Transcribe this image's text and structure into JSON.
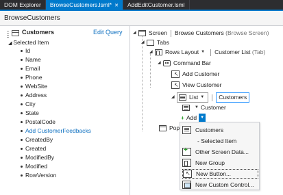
{
  "tabs": [
    {
      "label": "DOM Explorer"
    },
    {
      "label": "BrowseCustomers.lsml*"
    },
    {
      "label": "AddEditCustomer.lsml"
    }
  ],
  "header": {
    "title": "BrowseCustomers"
  },
  "left": {
    "title": "Customers",
    "edit_query": "Edit Query",
    "selected_item": "Selected Item",
    "fields": [
      "Id",
      "Name",
      "Email",
      "Phone",
      "WebSite",
      "Address",
      "City",
      "State",
      "PostalCode"
    ],
    "add_link": "Add CustomerFeedbacks",
    "fields2": [
      "CreatedBy",
      "Created",
      "ModifiedBy",
      "Modified",
      "RowVersion"
    ]
  },
  "tree": {
    "screen_label": "Screen",
    "screen_name": "Browse Customers",
    "screen_type": "(Browse Screen)",
    "tabs_label": "Tabs",
    "rows_layout": "Rows Layout",
    "customer_list": "Customer List",
    "tab_suffix": "(Tab)",
    "command_bar": "Command Bar",
    "add_customer": "Add Customer",
    "view_customer": "View Customer",
    "list_label": "List",
    "customers": "Customers",
    "customer": "Customer",
    "add_label": "Add",
    "popups_partial": "Pop"
  },
  "menu": {
    "items": [
      {
        "label": "Customers"
      },
      {
        "label": "- Selected Item"
      },
      {
        "label": "Other Screen Data..."
      },
      {
        "label": "New Group"
      },
      {
        "label": "New Button..."
      },
      {
        "label": "New Custom Control..."
      }
    ]
  }
}
